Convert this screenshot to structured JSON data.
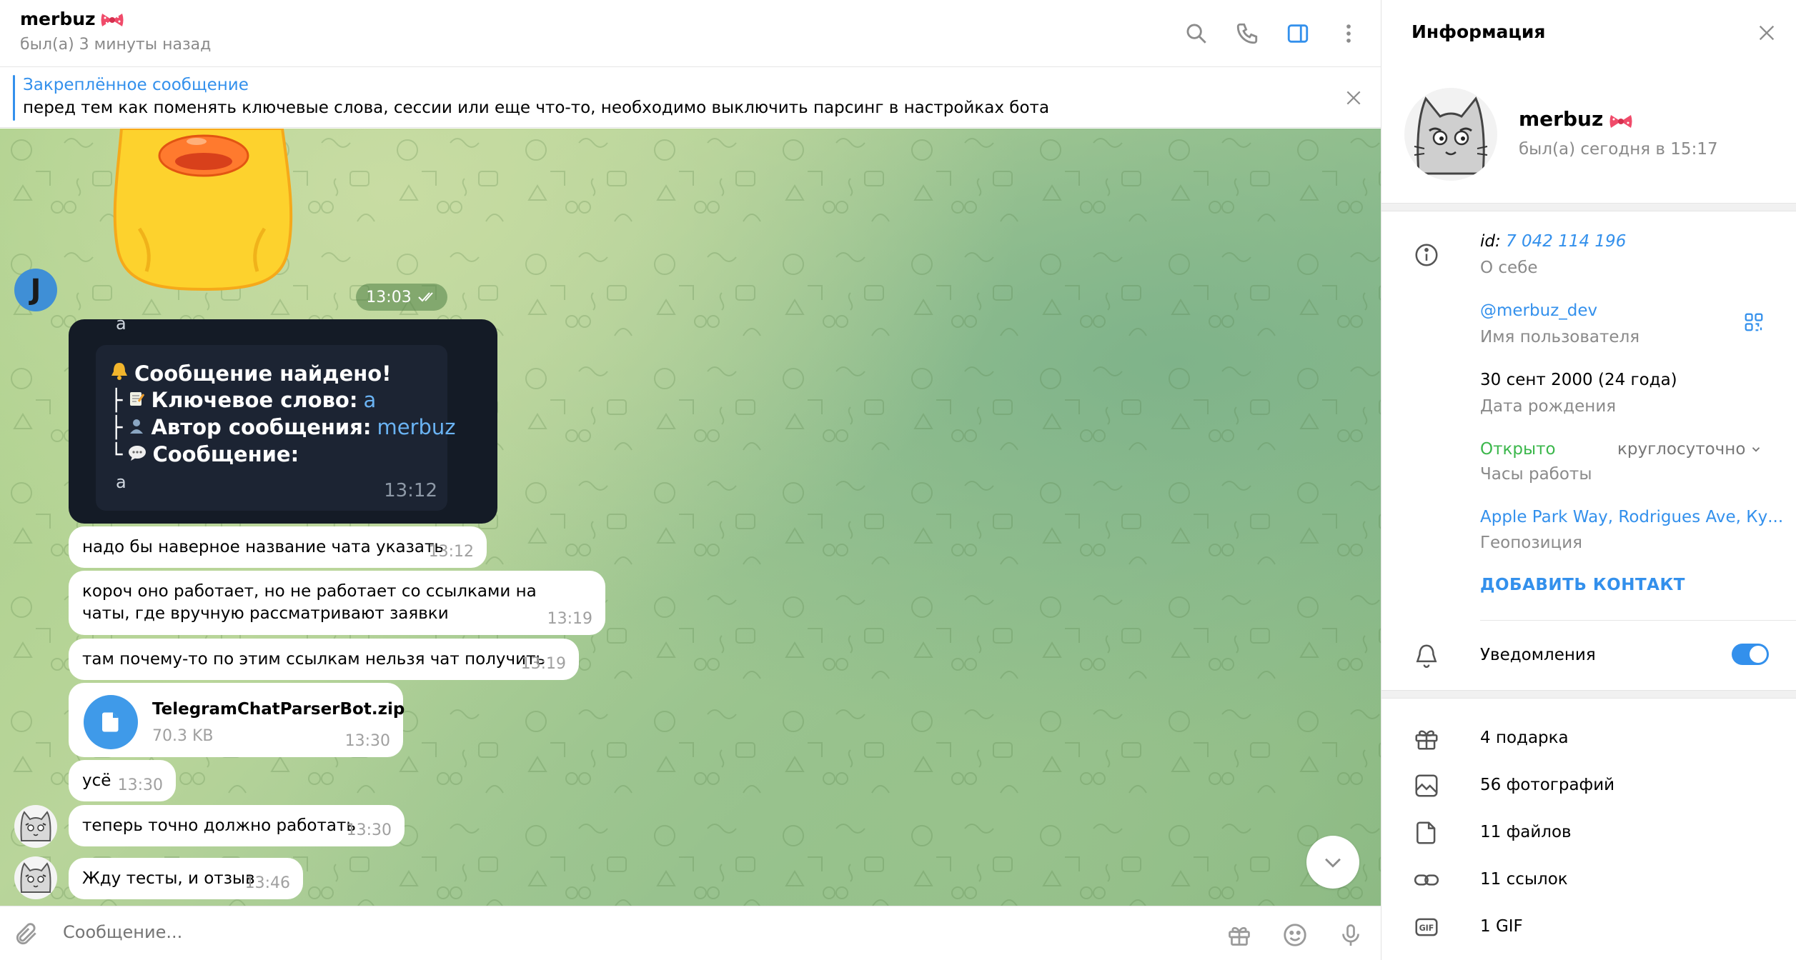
{
  "header": {
    "contact_name": "merbuz",
    "status": "был(а) 3 минуты назад",
    "icons": [
      "search-icon",
      "phone-icon",
      "sidebar-toggle-icon",
      "more-vertical-icon"
    ]
  },
  "pinned": {
    "title": "Закреплённое сообщение",
    "text": "перед тем как поменять ключевые слова, сессии или еще что-то, необходимо выключить парсинг в настройках бота"
  },
  "chat": {
    "sticker_time": "13:03",
    "sender_initial": "J",
    "screenshot": {
      "top_char": "a",
      "line1": "Сообщение найдено!",
      "line2_label": "Ключевое слово:",
      "line2_value": "a",
      "line3_label": "Автор сообщения:",
      "line3_value": "merbuz",
      "line4_label": "Сообщение:",
      "body": "a",
      "time": "13:12",
      "tree_1": "├",
      "tree_2": "├",
      "tree_3": "└"
    },
    "messages": [
      {
        "text": "надо бы наверное название чата указать",
        "time": "13:12"
      },
      {
        "text": "короч оно работает, но не работает со ссылками на чаты, где вручную рассматривают заявки",
        "time": "13:19"
      },
      {
        "text": "там почему-то по этим ссылкам нельзя чат получить",
        "time": "13:19"
      },
      {
        "text": "усё",
        "time": "13:30"
      },
      {
        "text": "теперь точно должно работать",
        "time": "13:30"
      },
      {
        "text": "Жду тесты, и отзыв",
        "time": "13:46"
      }
    ],
    "file": {
      "name": "TelegramChatParserBot.zip",
      "size": "70.3 KB",
      "time": "13:30"
    }
  },
  "composer": {
    "placeholder": "Сообщение..."
  },
  "info": {
    "title": "Информация",
    "name": "merbuz",
    "last_seen": "был(а) сегодня в 15:17",
    "id_label": "id:",
    "id_value": "7 042 114 196",
    "about_label": "О себе",
    "username": "@merbuz_dev",
    "username_label": "Имя пользователя",
    "birthday": "30 сент 2000 (24 года)",
    "birthday_label": "Дата рождения",
    "open_status": "Открыто",
    "hours": "круглосуточно",
    "hours_label": "Часы работы",
    "location": "Apple Park Way, Rodrigues Ave, Ку...",
    "location_label": "Геопозиция",
    "add_contact": "ДОБАВИТЬ КОНТАКТ",
    "notifications": "Уведомления",
    "notifications_on": true,
    "media": [
      {
        "label": "4 подарка",
        "icon": "gift-icon"
      },
      {
        "label": "56 фотографий",
        "icon": "photo-icon"
      },
      {
        "label": "11 файлов",
        "icon": "file-icon"
      },
      {
        "label": "11 ссылок",
        "icon": "link-icon"
      },
      {
        "label": "1 GIF",
        "icon": "gif-icon"
      }
    ]
  },
  "colors": {
    "accent": "#3390ec",
    "open": "#3bb74b",
    "bubble": "#ffffff",
    "time_text": "#a0a0a0"
  }
}
